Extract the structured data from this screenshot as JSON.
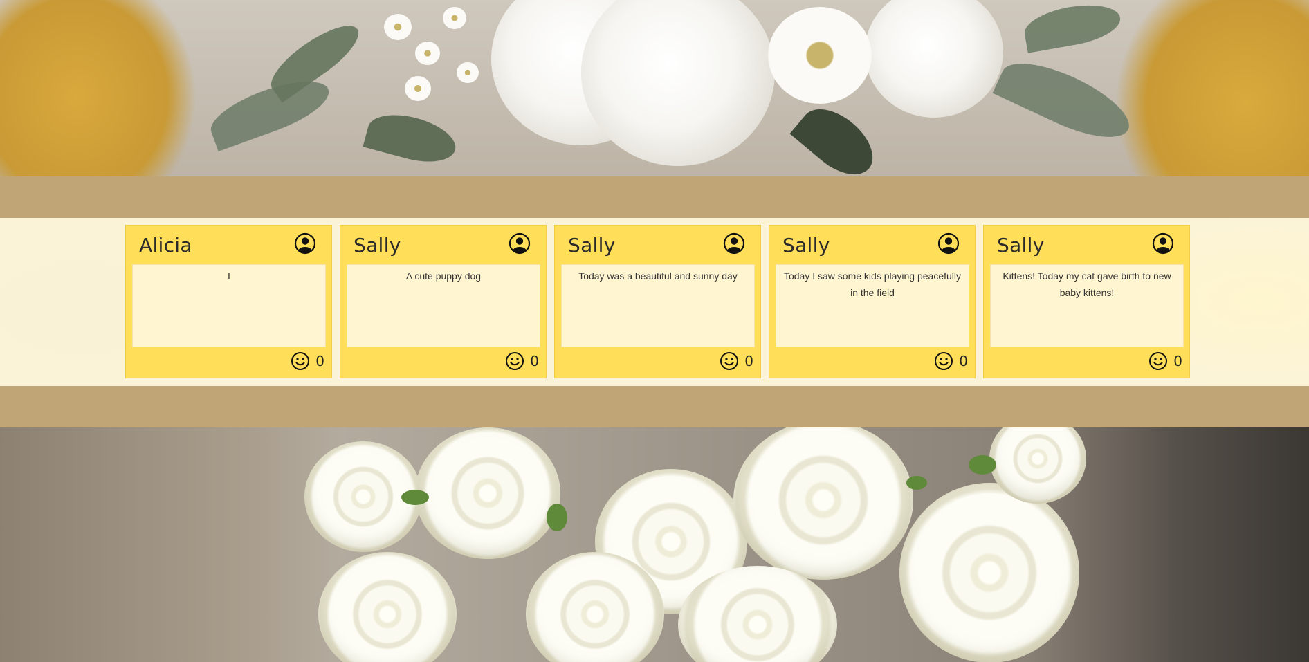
{
  "notes": [
    {
      "author": "Alicia",
      "message": "I",
      "likes": "0"
    },
    {
      "author": "Sally",
      "message": "A cute puppy dog",
      "likes": "0"
    },
    {
      "author": "Sally",
      "message": "Today was a beautiful and sunny day",
      "likes": "0"
    },
    {
      "author": "Sally",
      "message": "Today I saw some kids playing peacefully in the field",
      "likes": "0"
    },
    {
      "author": "Sally",
      "message": "Kittens! Today my cat gave birth to new baby kittens!",
      "likes": "0"
    }
  ],
  "icons": {
    "profile": "user-circle-icon",
    "like": "smiley-icon"
  },
  "colors": {
    "note_background": "#ffde59",
    "note_body": "#fff5d1",
    "band": "#c0a577",
    "strip": "#fbf3d8"
  }
}
